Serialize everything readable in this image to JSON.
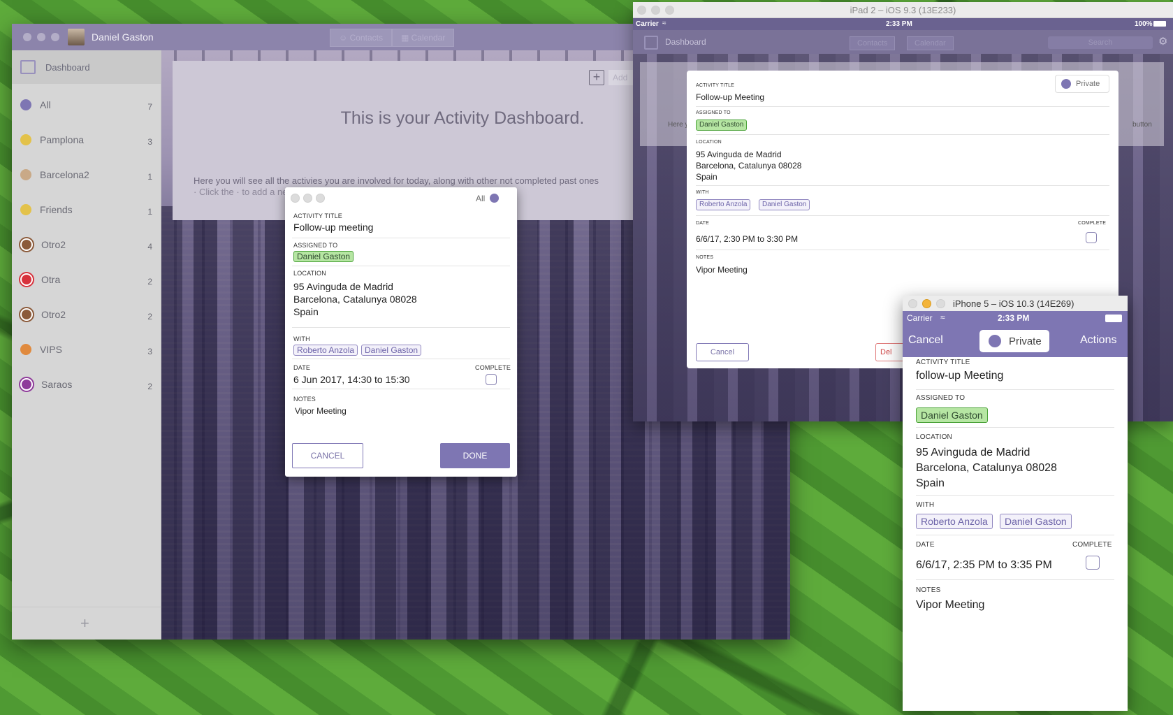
{
  "mac_app": {
    "user_name": "Daniel Gaston",
    "segments": [
      "Contacts",
      "Calendar"
    ],
    "sidebar": {
      "dashboard_label": "Dashboard",
      "items": [
        {
          "label": "All",
          "count": "7",
          "color": "#7e76b3",
          "style": "fill"
        },
        {
          "label": "Pamplona",
          "count": "3",
          "color": "#e3c24a",
          "style": "fill"
        },
        {
          "label": "Barcelona2",
          "count": "1",
          "color": "#c9a987",
          "style": "fill"
        },
        {
          "label": "Friends",
          "count": "1",
          "color": "#e3c24a",
          "style": "fill"
        },
        {
          "label": "Otro2",
          "count": "4",
          "color": "#8b5a3a",
          "style": "ring"
        },
        {
          "label": "Otra",
          "count": "2",
          "color": "#d7323c",
          "style": "ring"
        },
        {
          "label": "Otro2",
          "count": "2",
          "color": "#8b5a3a",
          "style": "ring"
        },
        {
          "label": "VIPS",
          "count": "3",
          "color": "#e08a3e",
          "style": "fill"
        },
        {
          "label": "Saraos",
          "count": "2",
          "color": "#8e3a9a",
          "style": "ring"
        }
      ],
      "add_symbol": "+"
    },
    "dashboard": {
      "title": "This is your Activity Dashboard.",
      "text_line1": "Here you will see all the activies you are involved for today, along with other not completed past ones",
      "text_line2": "· Click the · to add a new · or · to · · · · ·ng to start scheduling an act",
      "add_label": "Add"
    }
  },
  "mac_modal": {
    "filter_label": "All",
    "activity_title_label": "ACTIVITY TITLE",
    "activity_title": "Follow-up meeting",
    "assigned_to_label": "ASSIGNED TO",
    "assigned_to": "Daniel Gaston",
    "location_label": "LOCATION",
    "location_lines": [
      "95 Avinguda de Madrid",
      "Barcelona, Catalunya 08028",
      "Spain"
    ],
    "with_label": "WITH",
    "with": [
      "Roberto Anzola",
      "Daniel Gaston"
    ],
    "date_label": "DATE",
    "date": "6 Jun 2017, 14:30 to 15:30",
    "complete_label": "COMPLETE",
    "notes_label": "NOTES",
    "notes": "Vipor Meeting",
    "cancel": "CANCEL",
    "done": "DONE"
  },
  "ipad": {
    "window_title": "iPad 2 – iOS 9.3 (13E233)",
    "carrier": "Carrier",
    "time": "2:33 PM",
    "battery": "100%",
    "nav_title": "Dashboard",
    "nav_segments": [
      "Contacts",
      "Calendar"
    ],
    "search_placeholder": "Search",
    "bg_text_left": "Here y",
    "bg_text_right": "button",
    "modal": {
      "private_label": "Private",
      "activity_title_label": "ACTIVITY TITLE",
      "activity_title": "Follow-up Meeting",
      "assigned_to_label": "ASSIGNED TO",
      "assigned_to": "Daniel Gaston",
      "location_label": "LOCATION",
      "location_lines": [
        "95 Avinguda de Madrid",
        "Barcelona, Catalunya 08028",
        "Spain"
      ],
      "with_label": "WITH",
      "with": [
        "Roberto Anzola",
        "Daniel Gaston"
      ],
      "date_label": "DATE",
      "date": "6/6/17, 2:30 PM to 3:30 PM",
      "complete_label": "COMPLETE",
      "notes_label": "NOTES",
      "notes": "Vipor Meeting",
      "cancel": "Cancel",
      "delete": "Del"
    }
  },
  "iphone": {
    "window_title": "iPhone 5 – iOS 10.3 (14E269)",
    "carrier": "Carrier",
    "time": "2:33 PM",
    "cancel": "Cancel",
    "private_label": "Private",
    "actions": "Actions",
    "activity_title_label": "ACTIVITY TITLE",
    "activity_title": "follow-up Meeting",
    "assigned_to_label": "ASSIGNED TO",
    "assigned_to": "Daniel Gaston",
    "location_label": "LOCATION",
    "location_lines": [
      "95 Avinguda de Madrid",
      "Barcelona, Catalunya 08028",
      "Spain"
    ],
    "with_label": "WITH",
    "with": [
      "Roberto Anzola",
      "Daniel Gaston"
    ],
    "date_label": "DATE",
    "date": "6/6/17, 2:35 PM to 3:35 PM",
    "complete_label": "COMPLETE",
    "notes_label": "NOTES",
    "notes": "Vipor Meeting"
  },
  "colors": {
    "accent": "#7e76b3",
    "tag_green_bg": "#b6e6a3",
    "tag_green_border": "#4ba239"
  }
}
